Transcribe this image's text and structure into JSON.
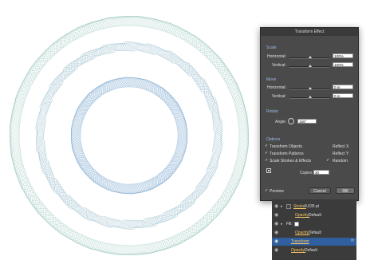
{
  "dialog": {
    "title": "Transform Effect",
    "scale": {
      "heading": "Scale",
      "horizontal_label": "Horizontal:",
      "horizontal_value": "100%",
      "vertical_label": "Vertical:",
      "vertical_value": "100%"
    },
    "move": {
      "heading": "Move",
      "horizontal_label": "Horizontal:",
      "horizontal_value": "0 in",
      "vertical_label": "Vertical:",
      "vertical_value": "0 in"
    },
    "rotate": {
      "heading": "Rotate",
      "angle_label": "Angle:",
      "angle_value": "156°"
    },
    "options": {
      "heading": "Options",
      "transform_objects": "Transform Objects",
      "transform_patterns": "Transform Patterns",
      "scale_strokes": "Scale Strokes & Effects",
      "reflect_x": "Reflect X",
      "reflect_y": "Reflect Y",
      "random": "Random",
      "transform_objects_checked": true,
      "transform_patterns_checked": true,
      "scale_strokes_checked": true,
      "reflect_x_checked": false,
      "reflect_y_checked": false,
      "random_checked": true
    },
    "copies_label": "Copies",
    "copies_value": "30",
    "preview_label": "Preview",
    "preview_checked": true,
    "cancel_label": "Cancel",
    "ok_label": "OK"
  },
  "layers": {
    "rows": [
      {
        "label": "Stroke:",
        "value": "0.035 pt"
      },
      {
        "label": "Opacity:",
        "value": "Default"
      },
      {
        "label": "Fill:",
        "value": ""
      },
      {
        "label": "Opacity:",
        "value": "Default"
      },
      {
        "label": "Transform",
        "value": "",
        "fx": "fx"
      },
      {
        "label": "Opacity:",
        "value": "Default"
      }
    ]
  },
  "colors": {
    "outer_ring": "#5fa59a",
    "inner_ring": "#3f7fb8",
    "dialog_bg": "#4a4a4a",
    "selection": "#2f5f9e"
  }
}
